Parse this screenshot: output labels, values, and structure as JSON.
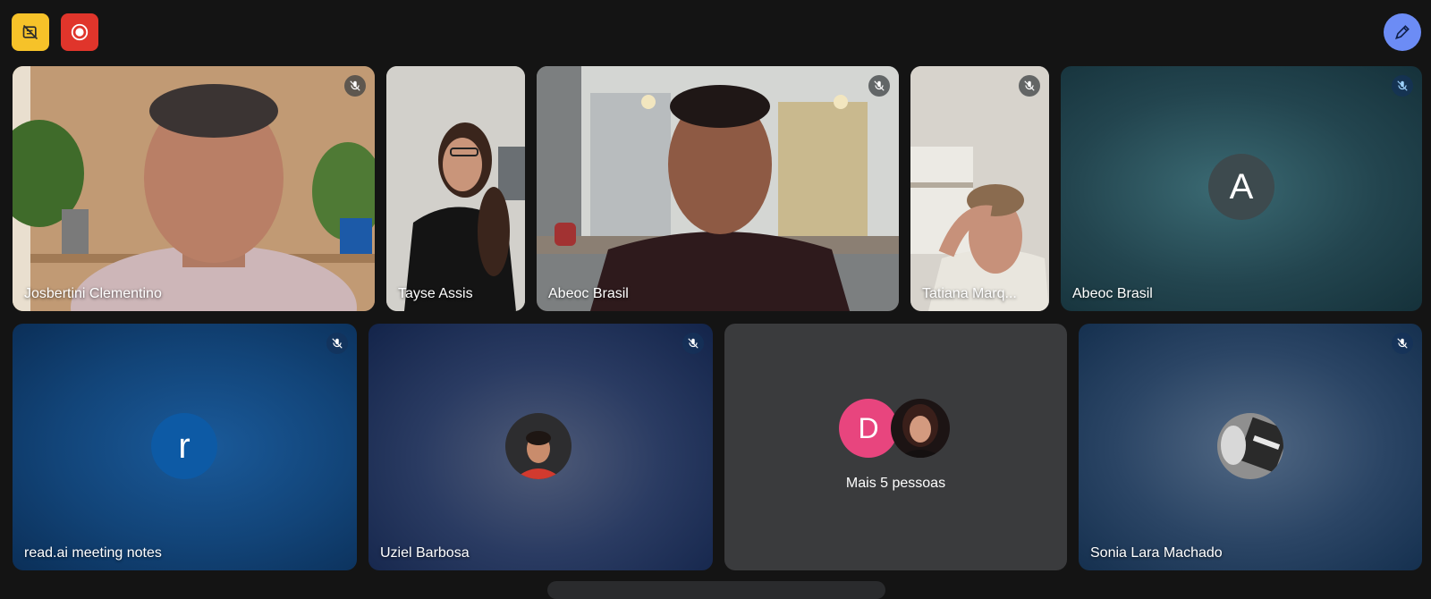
{
  "toolbar": {
    "left_buttons": [
      "no-video-layout-icon",
      "record-icon"
    ],
    "right_button": "edit-pen-icon"
  },
  "participants": [
    {
      "name": "Josbertini Clementino",
      "muted": true,
      "video": true
    },
    {
      "name": "Tayse Assis",
      "muted": false,
      "video": true
    },
    {
      "name": "Abeoc Brasil",
      "muted": true,
      "video": true
    },
    {
      "name": "Tatiana Marq...",
      "muted": true,
      "video": true
    },
    {
      "name": "Abeoc Brasil",
      "muted": true,
      "video": false,
      "avatar_letter": "A"
    },
    {
      "name": "read.ai meeting notes",
      "muted": true,
      "video": false,
      "avatar_letter": "r"
    },
    {
      "name": "Uziel Barbosa",
      "muted": true,
      "video": false
    },
    {
      "name": "Sonia Lara Machado",
      "muted": true,
      "video": false
    }
  ],
  "overflow_tile": {
    "avatar_letter": "D",
    "label": "Mais 5 pessoas"
  },
  "colors": {
    "background": "#141414",
    "record": "#e0352b",
    "effects": "#f6c229",
    "accent": "#6c8cf5",
    "pink_avatar": "#e8457e"
  }
}
